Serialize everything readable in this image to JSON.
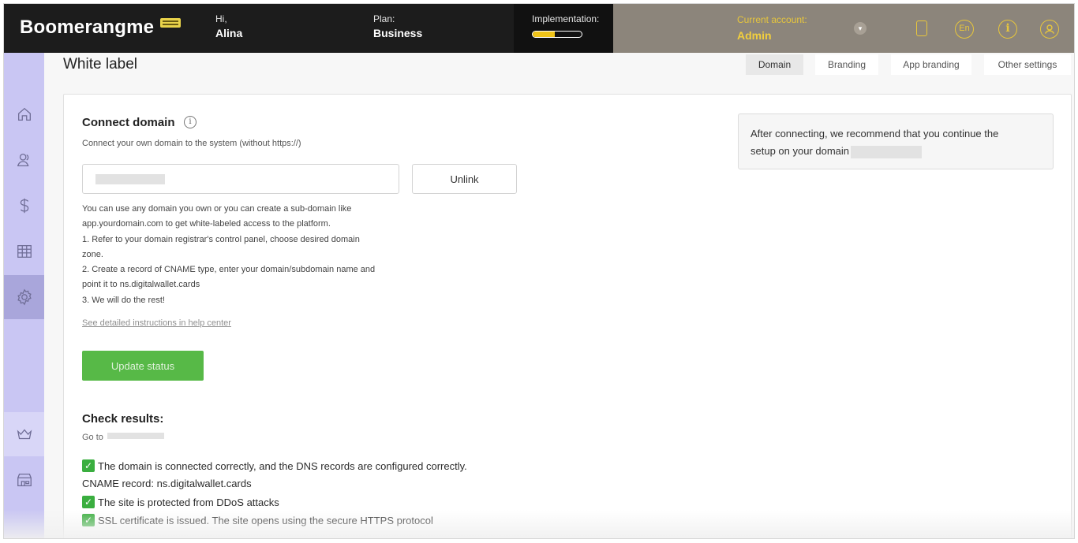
{
  "header": {
    "brand": "Boomerangme",
    "greeting_label": "Hi,",
    "user_name": "Alina",
    "plan_label": "Plan:",
    "plan_value": "Business",
    "implementation_label": "Implementation:",
    "implementation_progress": 0.45,
    "account_label": "Current account:",
    "account_value": "Admin",
    "language": "En",
    "info_glyph": "i",
    "icons": [
      "chevron-down-icon",
      "phone-icon",
      "language-icon",
      "info-icon",
      "profile-icon"
    ]
  },
  "sidebar": {
    "items": [
      "home-icon",
      "users-icon",
      "dollar-icon",
      "cards-icon",
      "settings-icon",
      "crown-icon",
      "store-icon"
    ],
    "active": "settings-icon"
  },
  "page": {
    "title": "White label",
    "tabs": [
      {
        "label": "Domain",
        "active": true
      },
      {
        "label": "Branding",
        "active": false
      },
      {
        "label": "App branding",
        "active": false
      },
      {
        "label": "Other settings",
        "active": false
      }
    ]
  },
  "domain": {
    "title": "Connect domain",
    "info_glyph": "i",
    "subtitle": "Connect your own domain to the system (without https://)",
    "input_value": "",
    "unlink_label": "Unlink",
    "help_lines": [
      "You can use any domain you own or you can create a sub-domain like",
      "app.yourdomain.com to get white-labeled access to the platform.",
      "1. Refer to your domain registrar's control panel, choose desired domain",
      "zone.",
      "2. Create a record of CNAME type, enter your domain/subdomain name and",
      "point it to ns.digitalwallet.cards",
      "3. We will do the rest!"
    ],
    "help_link": "See detailed instructions in help center",
    "update_label": "Update status"
  },
  "check": {
    "title": "Check results:",
    "goto_label": "Go to",
    "results": [
      {
        "check": true,
        "text": "The domain is connected correctly, and the DNS records are configured correctly."
      },
      {
        "check": false,
        "text": "CNAME record: ns.digitalwallet.cards"
      },
      {
        "check": true,
        "text": "The site is protected from DDoS attacks"
      },
      {
        "check": true,
        "text": "SSL certificate is issued. The site opens using the secure HTTPS protocol"
      }
    ]
  },
  "note": {
    "line1": "After connecting, we recommend that you continue the",
    "line2": "setup on your domain"
  },
  "colors": {
    "header_bg": "#1c1c1c",
    "account_bg": "#8c857b",
    "accent_yellow": "#e7c63c",
    "sidebar_bg": "#c9c6f3",
    "sidebar_active": "#a9a6db",
    "primary_green": "#57b947"
  }
}
